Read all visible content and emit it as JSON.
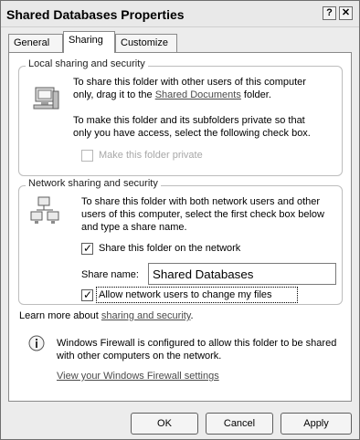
{
  "window": {
    "title": "Shared Databases Properties",
    "help_glyph": "?",
    "close_glyph": "✕"
  },
  "tabs": [
    {
      "label": "General"
    },
    {
      "label": "Sharing"
    },
    {
      "label": "Customize"
    }
  ],
  "local_sharing": {
    "legend": "Local sharing and security",
    "line1": "To share this folder with other users of this computer",
    "line2_prefix": "only, drag it to the ",
    "link": "Shared Documents",
    "line2_suffix": " folder.",
    "private_line1": "To make this folder and its subfolders private so that",
    "private_line2": "only you have access, select the following check box.",
    "private_checkbox_label": "Make this folder private",
    "private_checked": false
  },
  "network_sharing": {
    "legend": "Network sharing and security",
    "line1": "To share this folder with both network users and other",
    "line2": "users of this computer, select the first check box below",
    "line3": "and type a share name.",
    "share_checkbox_label": "Share this folder on the network",
    "share_checked": true,
    "share_name_label": "Share name:",
    "share_name_value": "Shared Databases",
    "allow_checkbox_label": "Allow network users to change my files",
    "allow_checked": true
  },
  "learn_more": {
    "prefix": "Learn more about ",
    "link": "sharing and security",
    "suffix": "."
  },
  "firewall": {
    "line1": "Windows Firewall is configured to allow this folder to be shared",
    "line2": "with other computers on the network.",
    "link": "View your Windows Firewall settings"
  },
  "buttons": {
    "ok": "OK",
    "cancel": "Cancel",
    "apply": "Apply"
  }
}
